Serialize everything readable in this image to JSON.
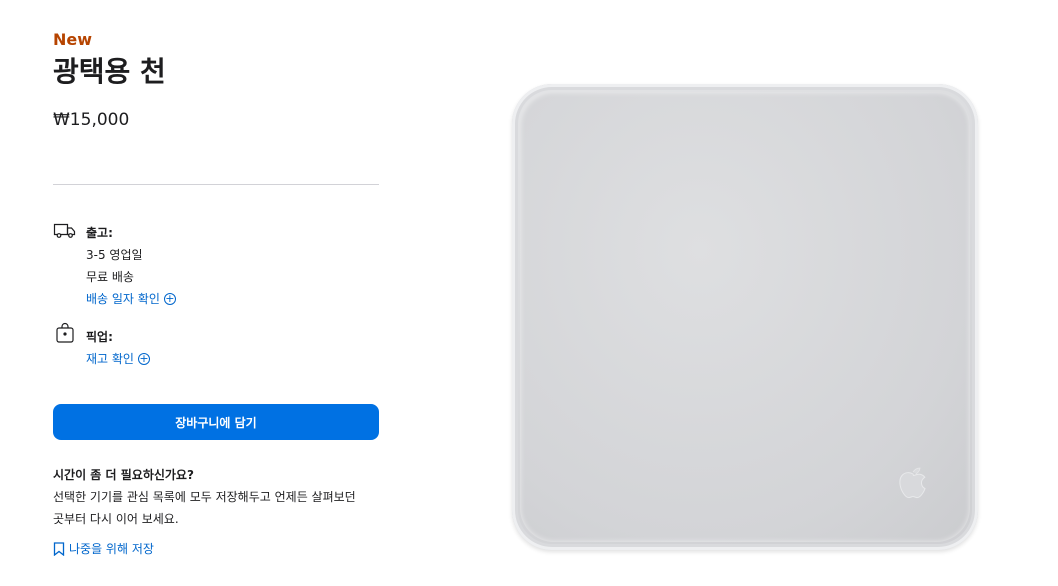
{
  "product": {
    "badge": "New",
    "title": "광택용 천",
    "price": "₩15,000"
  },
  "shipping": {
    "label": "출고:",
    "days": "3-5 영업일",
    "free": "무료 배송",
    "check_link": "배송 일자 확인"
  },
  "pickup": {
    "label": "픽업:",
    "check_link": "재고 확인"
  },
  "cart_button": "장바구니에 담기",
  "help": {
    "title": "시간이 좀 더 필요하신가요?",
    "line1": "선택한 기기를 관심 목록에 모두 저장해두고 언제든 살펴보던",
    "line2": "곳부터 다시 이어 보세요.",
    "save_link": "나중을 위해 저장"
  },
  "colors": {
    "badge": "#b64400",
    "link": "#0066cc",
    "button": "#0071e3"
  },
  "icons": [
    "truck-icon",
    "shopping-bag-icon",
    "plus-circle-icon",
    "bookmark-icon",
    "apple-logo-icon"
  ]
}
